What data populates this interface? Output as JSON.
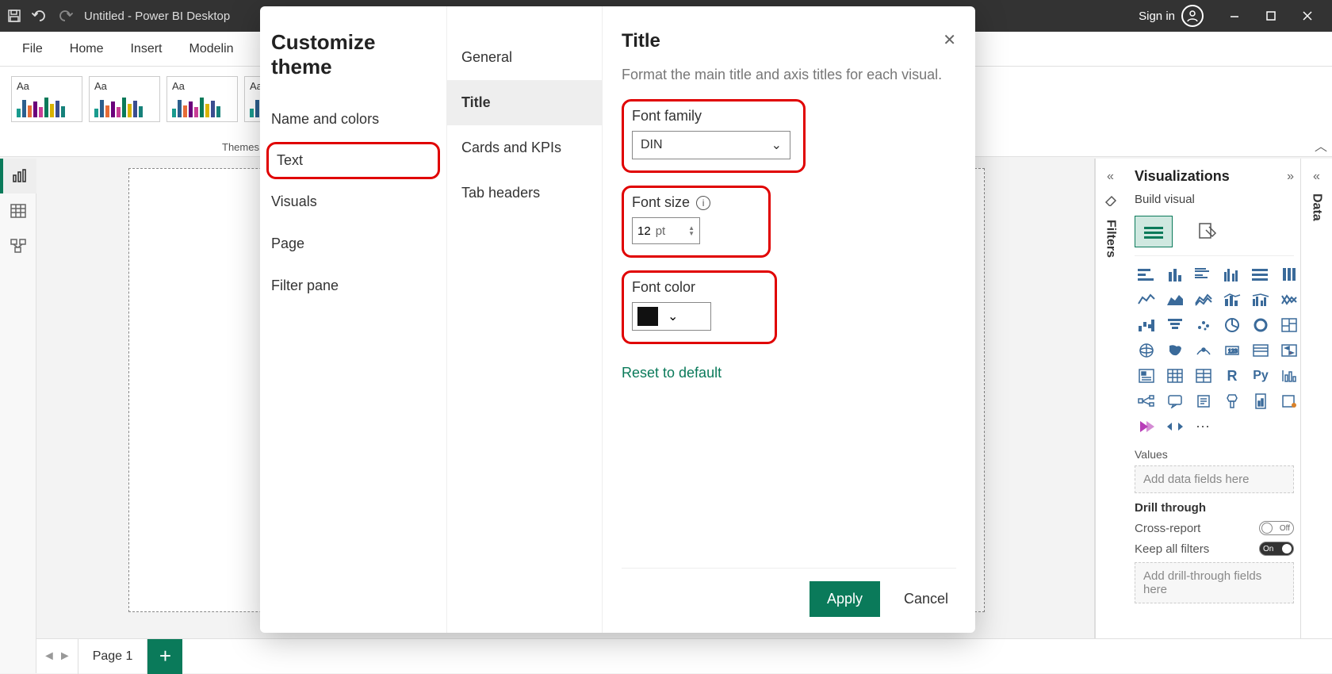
{
  "titlebar": {
    "app_title": "Untitled - Power BI Desktop",
    "signin_label": "Sign in"
  },
  "ribbon": {
    "tabs": [
      "File",
      "Home",
      "Insert",
      "Modelin"
    ],
    "themes_group_label": "Themes",
    "theme_thumb_label": "Aa"
  },
  "page_footer": {
    "page_label": "Page 1"
  },
  "dialog": {
    "title": "Customize theme",
    "nav": [
      "Name and colors",
      "Text",
      "Visuals",
      "Page",
      "Filter pane"
    ],
    "nav_active": "Text",
    "categories": [
      "General",
      "Title",
      "Cards and KPIs",
      "Tab headers"
    ],
    "category_active": "Title",
    "panel": {
      "heading": "Title",
      "description": "Format the main title and axis titles for each visual.",
      "font_family_label": "Font family",
      "font_family_value": "DIN",
      "font_size_label": "Font size",
      "font_size_value": "12",
      "font_size_unit": "pt",
      "font_color_label": "Font color",
      "font_color_value": "#111111",
      "reset_label": "Reset to default"
    },
    "apply_label": "Apply",
    "cancel_label": "Cancel"
  },
  "right_panes": {
    "filters_label": "Filters",
    "data_label": "Data",
    "viz_title": "Visualizations",
    "build_label": "Build visual",
    "values_label": "Values",
    "values_placeholder": "Add data fields here",
    "drill_header": "Drill through",
    "cross_report_label": "Cross-report",
    "cross_report_state": "Off",
    "keep_filters_label": "Keep all filters",
    "keep_filters_state": "On",
    "drill_placeholder": "Add drill-through fields here"
  }
}
